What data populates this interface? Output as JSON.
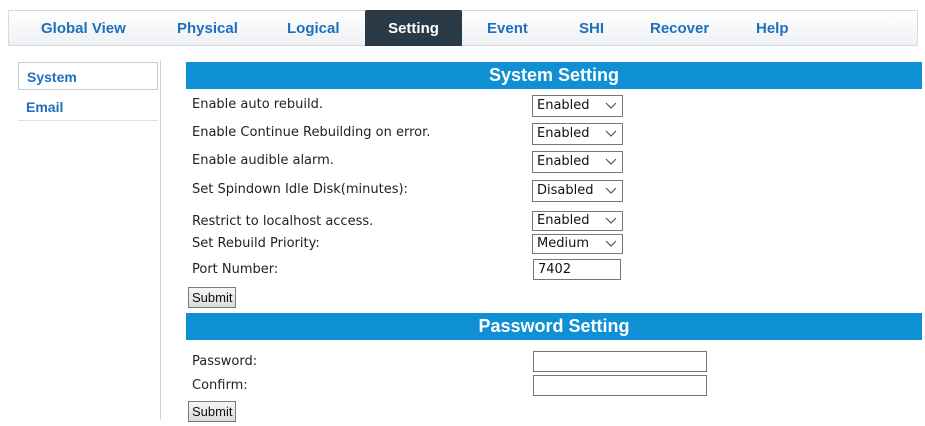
{
  "nav": {
    "tabs": [
      {
        "label": "Global View"
      },
      {
        "label": "Physical"
      },
      {
        "label": "Logical"
      },
      {
        "label": "Setting"
      },
      {
        "label": "Event"
      },
      {
        "label": "SHI"
      },
      {
        "label": "Recover"
      },
      {
        "label": "Help"
      }
    ],
    "active_tab": "Setting"
  },
  "sidebar": {
    "items": [
      {
        "label": "System"
      },
      {
        "label": "Email"
      }
    ],
    "selected": "System"
  },
  "system_setting": {
    "title": "System Setting",
    "rows": [
      {
        "label": "Enable auto rebuild.",
        "value": "Enabled"
      },
      {
        "label": "Enable Continue Rebuilding on error.",
        "value": "Enabled"
      },
      {
        "label": "Enable audible alarm.",
        "value": "Enabled"
      },
      {
        "label": "Set Spindown Idle Disk(minutes):",
        "value": "Disabled"
      },
      {
        "label": "Restrict to localhost access.",
        "value": "Enabled"
      },
      {
        "label": "Set Rebuild Priority:",
        "value": "Medium"
      }
    ],
    "port_label": "Port Number:",
    "port_value": "7402",
    "submit_label": "Submit"
  },
  "password_setting": {
    "title": "Password Setting",
    "password_label": "Password:",
    "password_value": "",
    "confirm_label": "Confirm:",
    "confirm_value": "",
    "submit_label": "Submit"
  },
  "colors": {
    "accent": "#0f8fd4",
    "link": "#1f6fbf",
    "active_tab_bg": "#2b3a47"
  }
}
